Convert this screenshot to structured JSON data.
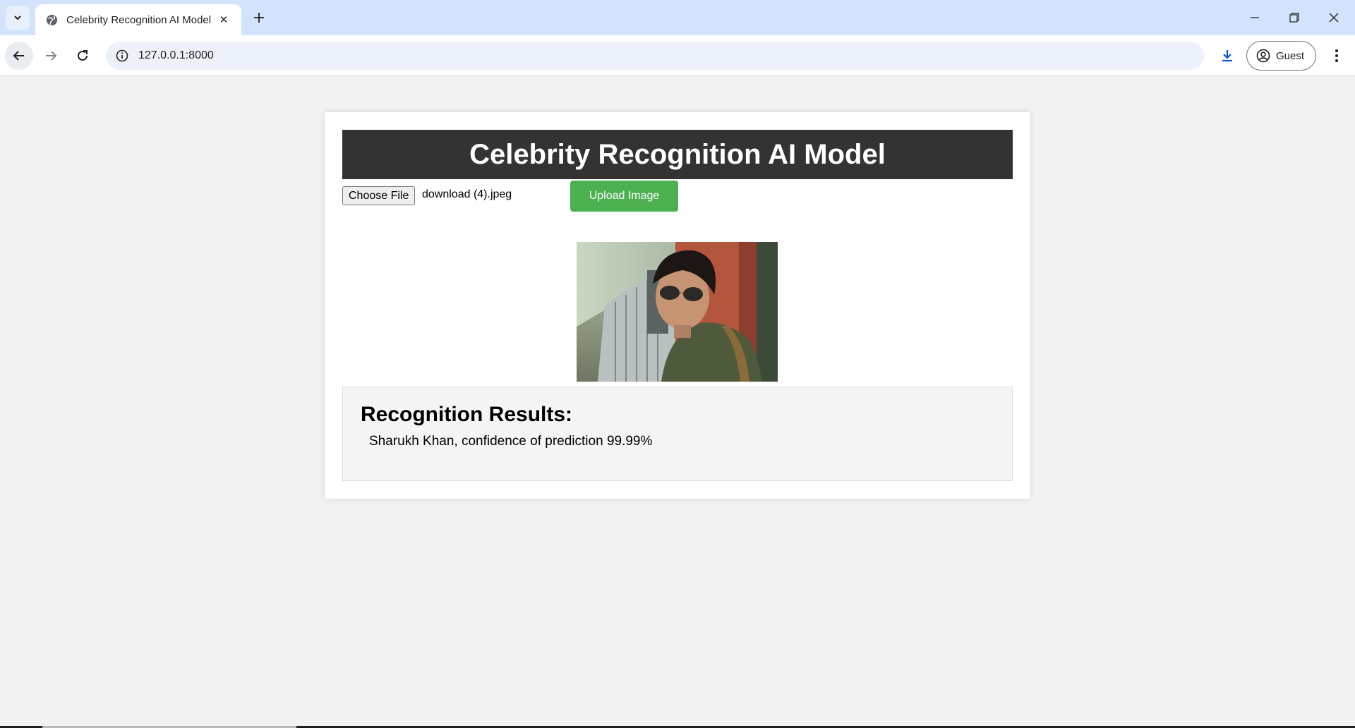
{
  "browser": {
    "tab_title": "Celebrity Recognition AI Model",
    "url": "127.0.0.1:8000",
    "profile_label": "Guest"
  },
  "page": {
    "heading": "Celebrity Recognition AI Model",
    "file_button_label": "Choose File",
    "selected_file": "download (4).jpeg",
    "upload_button_label": "Upload Image",
    "results_heading": "Recognition Results:",
    "result_text": "Sharukh Khan, confidence of prediction 99.99%",
    "accent_color": "#4caf50",
    "header_color": "#333333"
  }
}
